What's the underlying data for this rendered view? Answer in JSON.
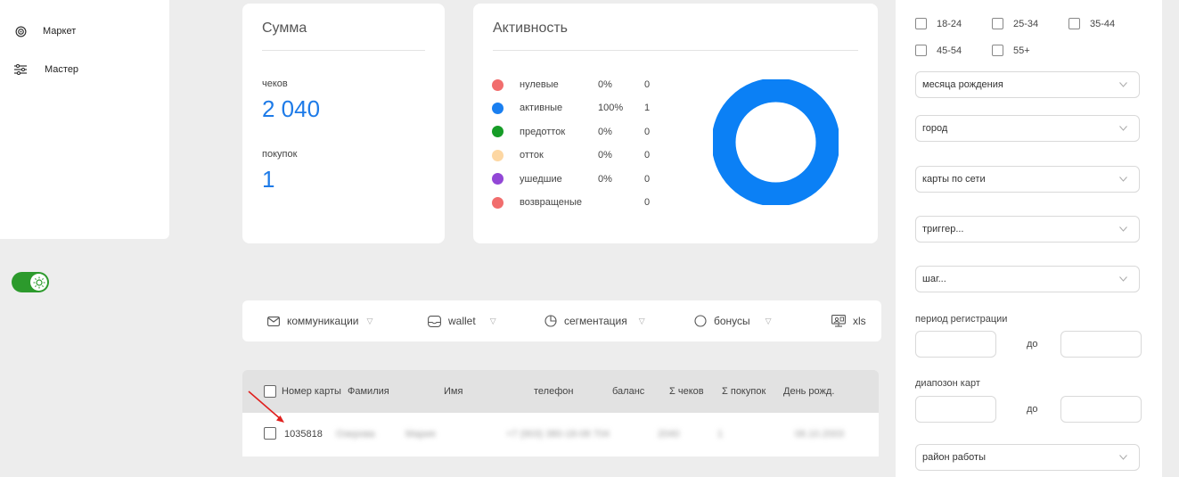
{
  "sidebar": {
    "items": [
      {
        "label": "Маркет",
        "icon": "target-icon"
      },
      {
        "label": "Мастер",
        "icon": "sliders-icon"
      }
    ]
  },
  "summary": {
    "title": "Сумма",
    "checks_label": "чеков",
    "checks_value": "2 040",
    "purchases_label": "покупок",
    "purchases_value": "1"
  },
  "activity": {
    "title": "Активность",
    "legend": [
      {
        "name": "нулевые",
        "pct": "0%",
        "count": "0",
        "color": "#f16d6d"
      },
      {
        "name": "активные",
        "pct": "100%",
        "count": "1",
        "color": "#1a7ff0"
      },
      {
        "name": "предотток",
        "pct": "0%",
        "count": "0",
        "color": "#169c27"
      },
      {
        "name": "отток",
        "pct": "0%",
        "count": "0",
        "color": "#fdd7a3"
      },
      {
        "name": "ушедшие",
        "pct": "0%",
        "count": "0",
        "color": "#9247d6"
      },
      {
        "name": "возвращеные",
        "pct": "",
        "count": "0",
        "color": "#f16d6d"
      }
    ],
    "donut_color": "#0b80f5"
  },
  "toolbar": {
    "communications": "коммуникации",
    "wallet": "wallet",
    "segmentation": "сегментация",
    "bonuses": "бонусы",
    "xls": "xls"
  },
  "table": {
    "headers": {
      "card": "Номер карты",
      "surname": "Фамилия",
      "name": "Имя",
      "phone": "телефон",
      "balance": "баланс",
      "checks": "Σ чеков",
      "purchases": "Σ покупок",
      "birthday": "День рожд."
    },
    "rows": [
      {
        "card": "1035818",
        "surname": "Озерова",
        "name": "Мария",
        "phone": "+7 (903) 380-18-08 704",
        "balance": "2040",
        "checks": "1",
        "birthday": "06.10.2003"
      }
    ]
  },
  "filters": {
    "ages": [
      "18-24",
      "25-34",
      "35-44",
      "45-54",
      "55+"
    ],
    "birth_month": "месяца рождения",
    "city": "город",
    "network_cards": "карты по сети",
    "trigger": "триггер...",
    "step": "шаг...",
    "reg_period_label": "период регистрации",
    "to1": "до",
    "card_range_label": "диапозон карт",
    "to2": "до",
    "work_area": "район работы"
  }
}
